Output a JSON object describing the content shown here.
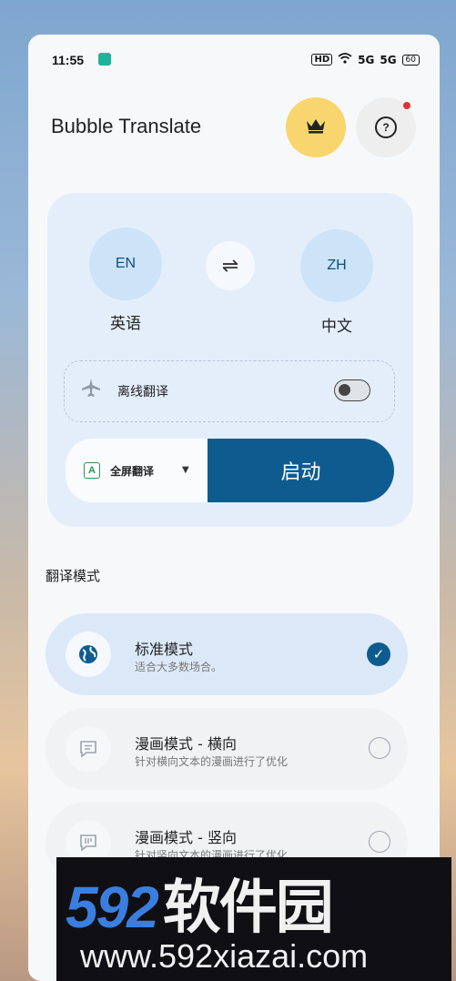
{
  "status_bar": {
    "time": "11:55",
    "hd": "HD",
    "wifi_icon": "wifi-icon",
    "signal1": "5G",
    "signal2": "5G",
    "battery": "60"
  },
  "header": {
    "app_title": "Bubble Translate",
    "crown_icon": "crown-icon",
    "help_label": "?"
  },
  "languages": {
    "source_code": "EN",
    "source_name": "英语",
    "swap_symbol": "⇌",
    "target_code": "ZH",
    "target_name": "中文"
  },
  "offline": {
    "label": "离线翻译",
    "enabled": false
  },
  "controls": {
    "mode_icon_letter": "A",
    "mode_select_label": "全屏翻译",
    "start_label": "启动"
  },
  "section_title": "翻译模式",
  "modes": [
    {
      "title": "标准模式",
      "desc": "适合大多数场合。",
      "selected": true,
      "icon": "globe-icon"
    },
    {
      "title": "漫画模式 - 横向",
      "desc": "针对横向文本的漫画进行了优化",
      "selected": false,
      "icon": "chat-bubble-icon"
    },
    {
      "title": "漫画模式 - 竖向",
      "desc": "针对竖向文本的漫画进行了优化",
      "selected": false,
      "icon": "vertical-text-icon"
    }
  ],
  "watermark": {
    "brand_num": "592",
    "brand_cn": "软件园",
    "url": "www.592xiazai.com"
  },
  "colors": {
    "accent": "#0e5c8f",
    "crown_bg": "#f8d66d",
    "card_bg": "#e4eefb"
  }
}
